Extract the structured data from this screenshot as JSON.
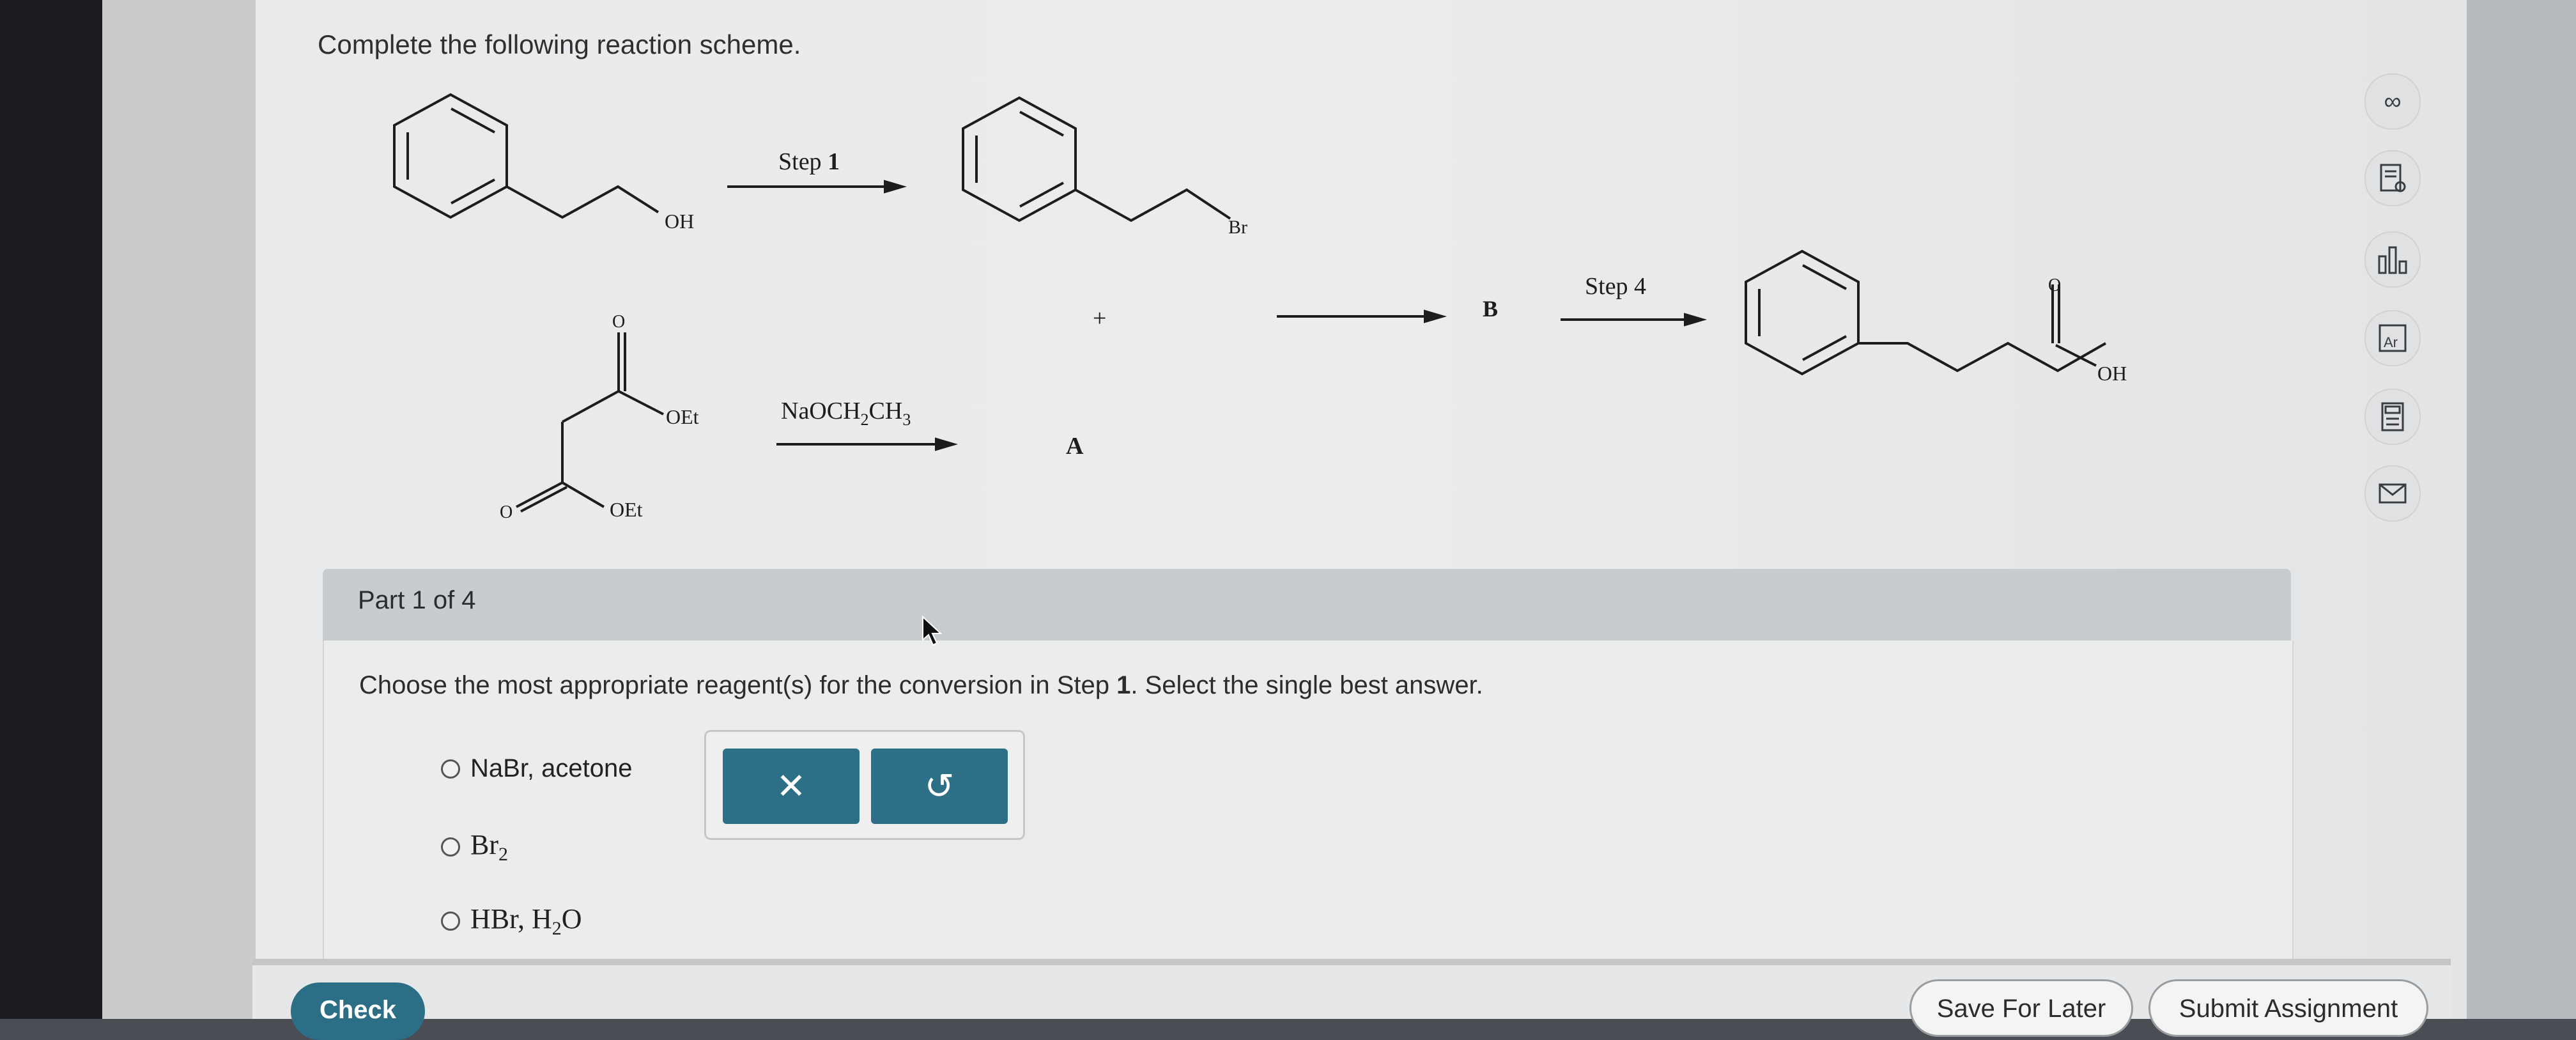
{
  "question_title": "Complete the following reaction scheme.",
  "scheme": {
    "step1_label": "Step 1",
    "step1_bold": "1",
    "step4_label": "Step 4",
    "reagent_base": "NaOCH",
    "reagent_sub1": "2",
    "reagent_mid": "CH",
    "reagent_sub2": "3",
    "product_A": "A",
    "product_B": "B",
    "plus": "+",
    "oh_label": "OH",
    "br_label": "Br",
    "oet_label": "OEt",
    "o_label": "O"
  },
  "part": {
    "label": "Part 1 of 4",
    "question_pre": "Choose the most appropriate reagent(s) for the conversion in Step ",
    "question_bold": "1",
    "question_post": ". Select the single best answer.",
    "options": [
      {
        "main": "NaBr, acetone"
      },
      {
        "main": "Br",
        "sub": "2"
      },
      {
        "main": "HBr, H",
        "sub": "2",
        "tail": "O"
      }
    ]
  },
  "tools": {
    "clear_symbol": "✕",
    "undo_symbol": "↺"
  },
  "sidebar": [
    "glasses-icon",
    "notes-icon",
    "chart-icon",
    "periodic-table-icon",
    "calculator-icon",
    "mail-icon"
  ],
  "footer": {
    "check": "Check",
    "save": "Save For Later",
    "submit": "Submit Assignment"
  },
  "colors": {
    "accent": "#2d6f86",
    "header_bg": "#c9cccf"
  }
}
